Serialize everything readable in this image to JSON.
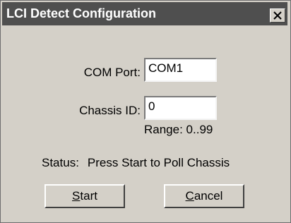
{
  "window": {
    "title": "LCI Detect Configuration",
    "close_symbol": "×"
  },
  "form": {
    "com_port_label": "COM Port:",
    "com_port_value": "COM1",
    "chassis_id_label": "Chassis ID:",
    "chassis_id_value": "0",
    "chassis_id_range": "Range: 0..99",
    "status_label": "Status:",
    "status_value": "Press Start to Poll Chassis"
  },
  "buttons": {
    "start": {
      "mnemonic": "S",
      "rest": "tart"
    },
    "cancel": {
      "mnemonic": "C",
      "rest": "ancel"
    }
  },
  "colors": {
    "titlebar": "#4f4f4f",
    "face": "#d4d0c8"
  }
}
